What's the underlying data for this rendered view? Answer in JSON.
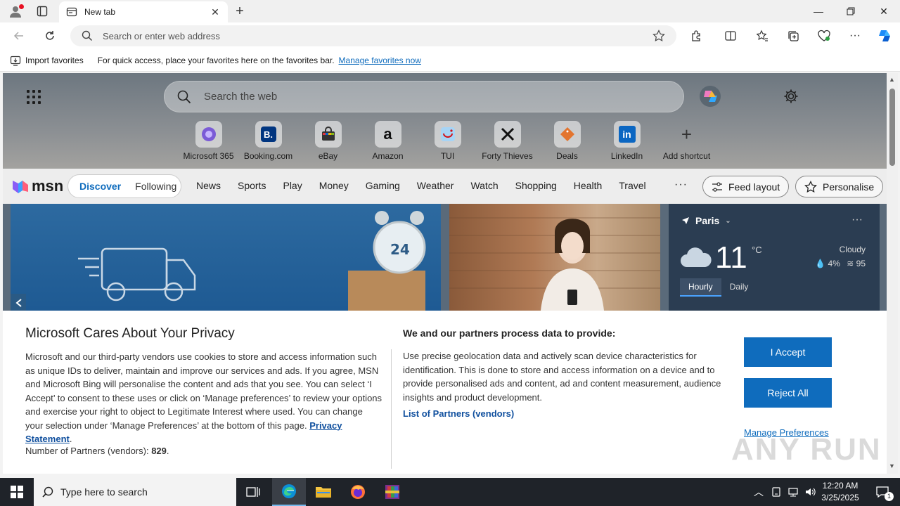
{
  "browser": {
    "tab_title": "New tab",
    "address_placeholder": "Search or enter web address"
  },
  "favorites_bar": {
    "import_label": "Import favorites",
    "hint": "For quick access, place your favorites here on the favorites bar.",
    "manage_link": "Manage favorites now"
  },
  "newtab": {
    "search_placeholder": "Search the web",
    "shortcuts": [
      {
        "label": "Microsoft 365",
        "icon": "microsoft365-icon"
      },
      {
        "label": "Booking.com",
        "icon": "booking-icon"
      },
      {
        "label": "eBay",
        "icon": "ebay-icon"
      },
      {
        "label": "Amazon",
        "icon": "amazon-icon"
      },
      {
        "label": "TUI",
        "icon": "tui-icon"
      },
      {
        "label": "Forty Thieves",
        "icon": "forty-thieves-icon"
      },
      {
        "label": "Deals",
        "icon": "deals-icon"
      },
      {
        "label": "LinkedIn",
        "icon": "linkedin-icon"
      },
      {
        "label": "Add shortcut",
        "icon": "plus-icon"
      }
    ]
  },
  "msn": {
    "logo": "msn",
    "tabs": [
      "Discover",
      "Following"
    ],
    "nav": [
      "News",
      "Sports",
      "Play",
      "Money",
      "Gaming",
      "Weather",
      "Watch",
      "Shopping",
      "Health",
      "Travel"
    ],
    "more": "···",
    "feed_layout": "Feed layout",
    "personalise": "Personalise"
  },
  "weather": {
    "city": "Paris",
    "temp": "11",
    "unit": "°C",
    "condition": "Cloudy",
    "precip": "4%",
    "wind": "95",
    "tabs": [
      "Hourly",
      "Daily"
    ]
  },
  "privacy": {
    "title": "Microsoft Cares About Your Privacy",
    "body": "Microsoft and our third-party vendors use cookies to store and access information such as unique IDs to deliver, maintain and improve our services and ads. If you agree, MSN and Microsoft Bing will personalise the content and ads that you see. You can select ‘I Accept’ to consent to these uses or click on ‘Manage preferences’ to review your options and exercise your right to object to Legitimate Interest where used.  You can change your selection under ‘Manage Preferences’ at the bottom of this page.",
    "privacy_link": "Privacy Statement",
    "partners_label": "Number of Partners (vendors):",
    "partners_count": "829",
    "right_title": "We and our partners process data to provide:",
    "right_body": "Use precise geolocation data and actively scan device characteristics for identification. This is done to store and access information on a device and to provide personalised ads and content, ad and content measurement, audience insights and product development.",
    "partners_link": "List of Partners (vendors)",
    "accept": "I Accept",
    "reject": "Reject All",
    "manage": "Manage Preferences"
  },
  "watermark": "ANY RUN",
  "taskbar": {
    "search_placeholder": "Type here to search",
    "time": "12:20 AM",
    "date": "3/25/2025",
    "notif_count": "1"
  }
}
